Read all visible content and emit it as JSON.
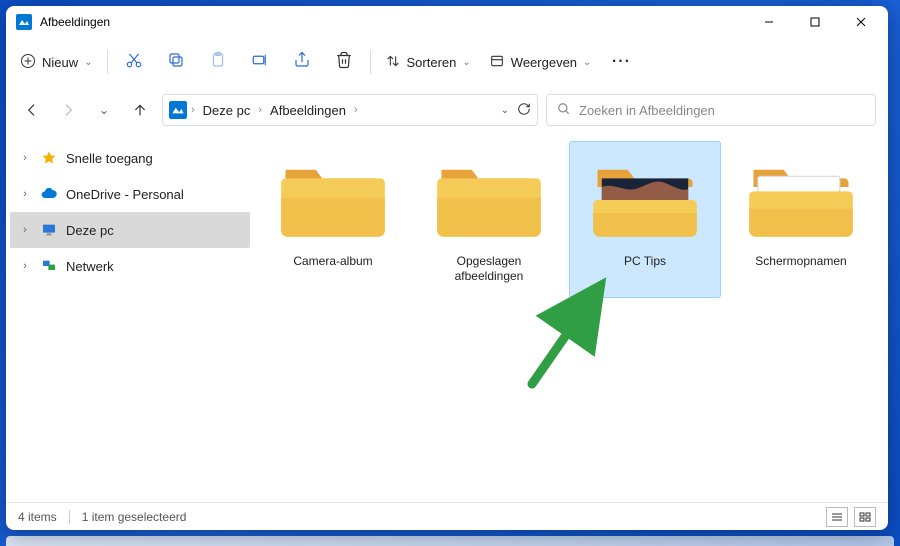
{
  "window": {
    "title": "Afbeeldingen"
  },
  "toolbar": {
    "new_label": "Nieuw",
    "sort_label": "Sorteren",
    "view_label": "Weergeven",
    "icons": {
      "cut": "cut-icon",
      "copy": "copy-icon",
      "paste": "paste-icon",
      "rename": "rename-icon",
      "share": "share-icon",
      "delete": "delete-icon"
    }
  },
  "breadcrumb": {
    "segments": [
      "Deze pc",
      "Afbeeldingen"
    ]
  },
  "search": {
    "placeholder": "Zoeken in Afbeeldingen"
  },
  "sidebar": {
    "items": [
      {
        "label": "Snelle toegang",
        "icon": "star",
        "selected": false
      },
      {
        "label": "OneDrive - Personal",
        "icon": "cloud",
        "selected": false
      },
      {
        "label": "Deze pc",
        "icon": "monitor",
        "selected": true
      },
      {
        "label": "Netwerk",
        "icon": "network",
        "selected": false
      }
    ]
  },
  "items": [
    {
      "label": "Camera-album",
      "hasPreview": false,
      "selected": false
    },
    {
      "label": "Opgeslagen afbeeldingen",
      "hasPreview": false,
      "selected": false
    },
    {
      "label": "PC Tips",
      "hasPreview": true,
      "selected": true
    },
    {
      "label": "Schermopnamen",
      "hasPreview": false,
      "selected": false
    }
  ],
  "statusbar": {
    "count_text": "4 items",
    "selection_text": "1 item geselecteerd"
  },
  "colors": {
    "accent": "#0078d4",
    "folder_main": "#f0c04a",
    "folder_tab": "#e8a23a",
    "selection_bg": "#cce8ff",
    "arrow": "#2f9e44"
  }
}
